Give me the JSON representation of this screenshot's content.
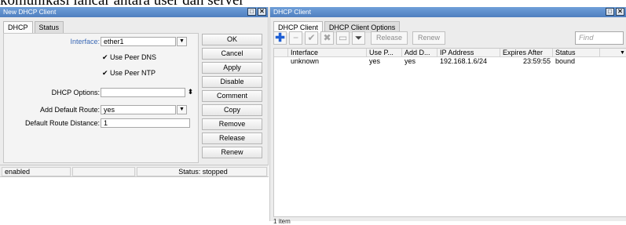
{
  "background_caption": "komunikasi lancar antara user dan server",
  "left_window": {
    "title": "New DHCP Client",
    "tabs": [
      "DHCP",
      "Status"
    ],
    "form": {
      "interface_label": "Interface:",
      "interface_value": "ether1",
      "use_peer_dns_label": "Use Peer DNS",
      "use_peer_dns_checked": true,
      "use_peer_ntp_label": "Use Peer NTP",
      "use_peer_ntp_checked": true,
      "dhcp_options_label": "DHCP Options:",
      "dhcp_options_value": "",
      "add_default_route_label": "Add Default Route:",
      "add_default_route_value": "yes",
      "default_route_distance_label": "Default Route Distance:",
      "default_route_distance_value": "1"
    },
    "buttons": [
      "OK",
      "Cancel",
      "Apply",
      "Disable",
      "Comment",
      "Copy",
      "Remove",
      "Release",
      "Renew"
    ],
    "status_bar": {
      "state": "enabled",
      "status": "Status: stopped"
    }
  },
  "right_window": {
    "title": "DHCP Client",
    "tabs": [
      "DHCP Client",
      "DHCP Client Options"
    ],
    "toolbar": {
      "release_label": "Release",
      "renew_label": "Renew",
      "find_placeholder": "Find"
    },
    "table": {
      "columns": [
        "Interface",
        "Use P...",
        "Add D...",
        "IP Address",
        "Expires After",
        "Status"
      ],
      "rows": [
        [
          "unknown",
          "yes",
          "yes",
          "192.168.1.6/24",
          "23:59:55",
          "bound"
        ]
      ]
    },
    "items_count": "1 item"
  },
  "colors": {
    "titlebar": "#5a8ace",
    "add_icon": "#1f5fd3",
    "label_blue": "#3a68b5"
  }
}
